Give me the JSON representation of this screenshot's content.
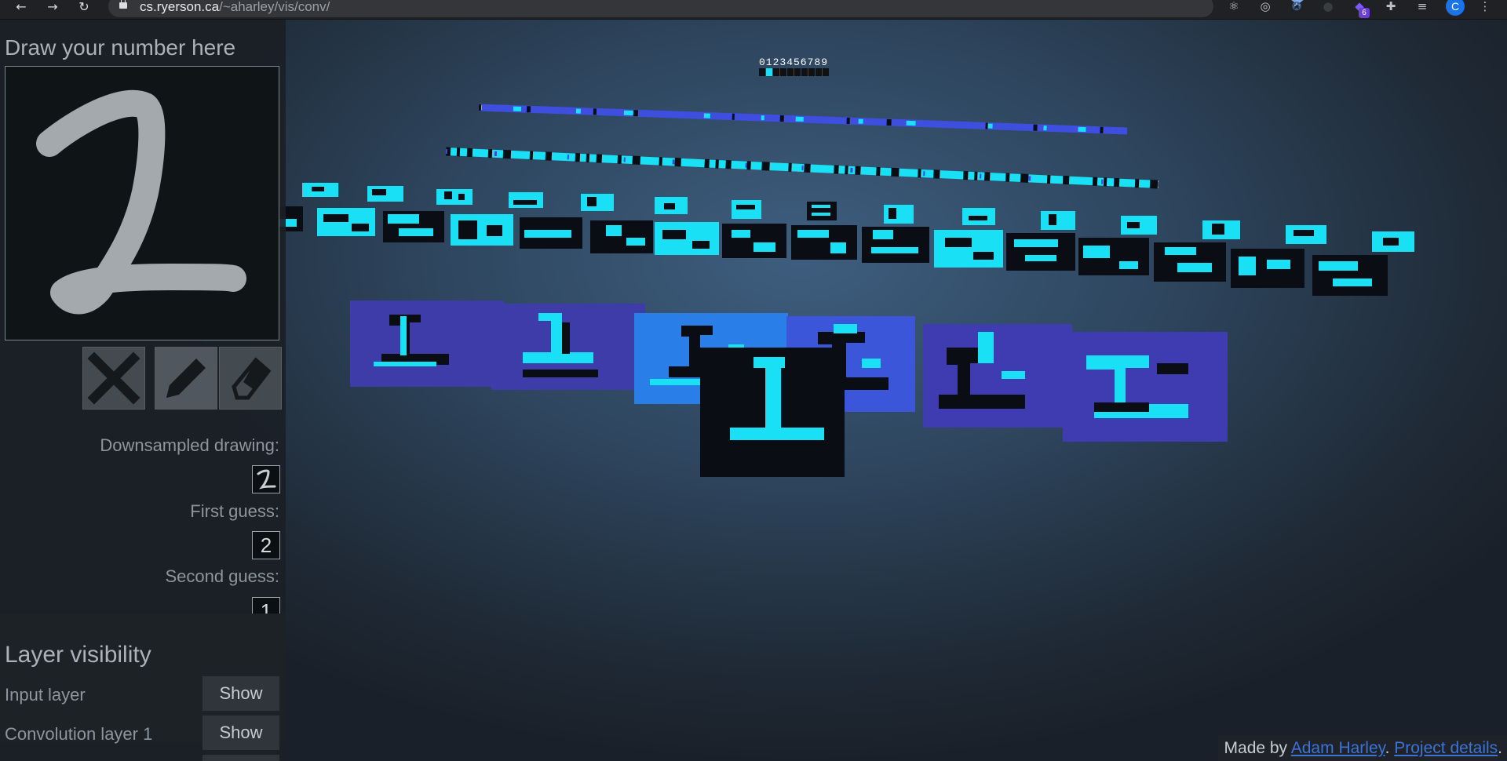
{
  "browser": {
    "url_host": "cs.ryerson.ca",
    "url_path": "/~aharley/vis/conv/",
    "extension_badge": "6",
    "profile_initial": "C"
  },
  "sidebar": {
    "draw_title": "Draw your number here",
    "downsampled_label": "Downsampled drawing:",
    "first_guess_label": "First guess:",
    "first_guess_value": "2",
    "second_guess_label": "Second guess:",
    "second_guess_value": "1",
    "tools": [
      "clear-icon",
      "pencil-icon",
      "eraser-icon"
    ]
  },
  "layers": {
    "title": "Layer visibility",
    "rows": [
      {
        "label": "Input layer",
        "button": "Show"
      },
      {
        "label": "Convolution layer 1",
        "button": "Show"
      }
    ]
  },
  "viz": {
    "output_digits": "0123456789"
  },
  "credit": {
    "prefix": "Made by ",
    "author": "Adam Harley",
    "separator": ". ",
    "details": "Project details",
    "suffix": "."
  },
  "colors": {
    "cyan": "#19e0f5",
    "blue": "#2a5ee0",
    "violet": "#5a3ec8",
    "dark": "#0a0d14"
  }
}
